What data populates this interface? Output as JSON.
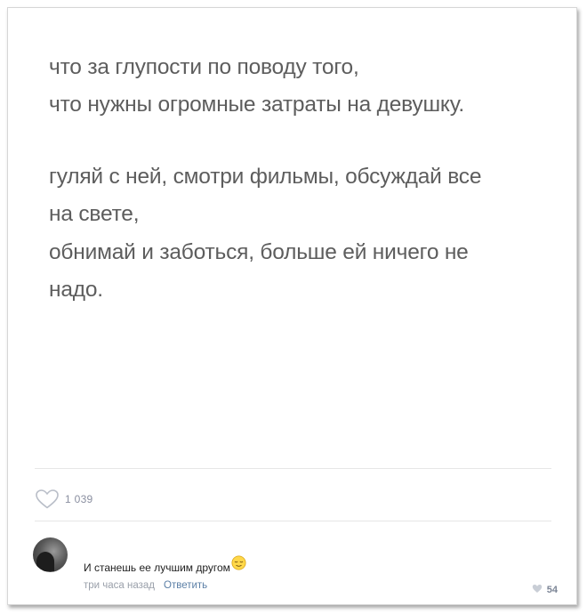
{
  "post": {
    "paragraphs": [
      {
        "lines": [
          "что за глупости по поводу того,",
          "что нужны огромные затраты на девушку."
        ]
      },
      {
        "lines": [
          "гуляй с ней, смотри фильмы, обсуждай все",
          "на свете,",
          "обнимай и заботься, больше ей ничего не",
          "надо."
        ]
      }
    ],
    "likes_count": "1 039",
    "like_icon": "heart-outline-icon"
  },
  "comment": {
    "text": "И станешь ее лучшим другом",
    "emoji_icon": "relieved-face-emoji",
    "time": "три часа назад",
    "reply_label": "Ответить",
    "likes_count": "54",
    "like_icon": "heart-icon"
  },
  "colors": {
    "text_primary": "#5d5d5d",
    "link": "#5b7fa6",
    "meta": "#9aa0aa",
    "heart_outline": "#b9bec8",
    "divider": "#e6e6e6"
  }
}
